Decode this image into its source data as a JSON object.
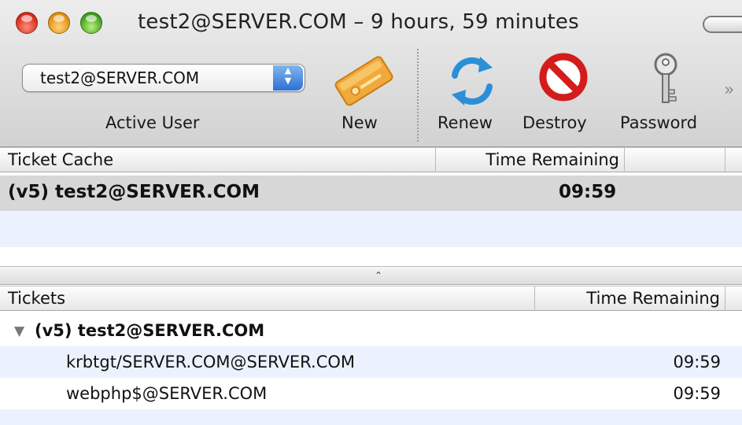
{
  "window": {
    "title": "test2@SERVER.COM – 9 hours, 59 minutes"
  },
  "toolbar": {
    "active_user": {
      "selected_value": "test2@SERVER.COM",
      "label": "Active User"
    },
    "new_label": "New",
    "renew_label": "Renew",
    "destroy_label": "Destroy",
    "password_label": "Password",
    "overflow_glyph": "»"
  },
  "ticket_cache": {
    "columns": [
      "Ticket Cache",
      "Time Remaining"
    ],
    "rows": [
      {
        "name": "(v5) test2@SERVER.COM",
        "time": "09:59",
        "selected": true
      }
    ]
  },
  "splitter": {
    "glyph": "⌃"
  },
  "tickets": {
    "columns": [
      "Tickets",
      "Time Remaining"
    ],
    "group": {
      "disclosure": "▼",
      "name": "(v5) test2@SERVER.COM"
    },
    "items": [
      {
        "name": "krbtgt/SERVER.COM@SERVER.COM",
        "time": "09:59"
      },
      {
        "name": "webphp$@SERVER.COM",
        "time": "09:59"
      }
    ]
  },
  "colors": {
    "selection_row": "#d7d7d7",
    "stripe_row": "#ebf2fe",
    "renew_blue": "#2b8fd8",
    "destroy_red": "#d41c1c",
    "ticket_orange": "#f2a93b"
  },
  "icons": {
    "new": "ticket-icon",
    "renew": "renew-arrows-icon",
    "destroy": "no-sign-icon",
    "password": "key-icon"
  }
}
